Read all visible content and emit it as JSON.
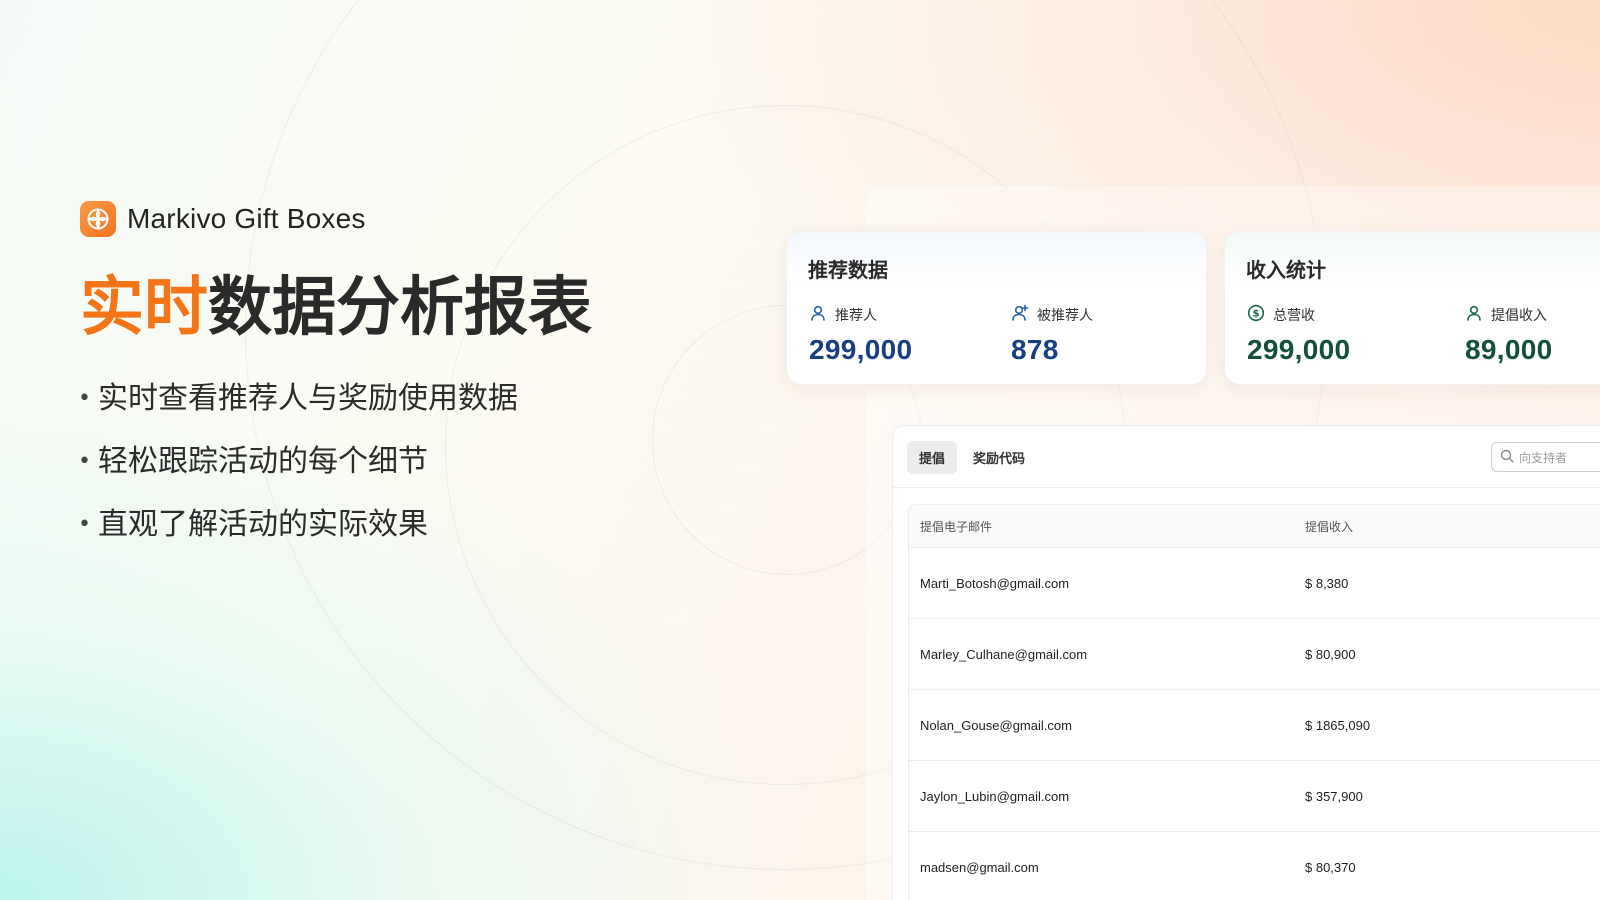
{
  "brand": {
    "name": "Markivo Gift Boxes"
  },
  "headline": {
    "accent": "实时",
    "rest": "数据分析报表"
  },
  "bullets": [
    "实时查看推荐人与奖励使用数据",
    "轻松跟踪活动的每个细节",
    "直观了解活动的实际效果"
  ],
  "referral_card": {
    "title": "推荐数据",
    "stats": [
      {
        "label": "推荐人",
        "value": "299,000",
        "icon": "user-icon"
      },
      {
        "label": "被推荐人",
        "value": "878",
        "icon": "user-add-icon"
      }
    ]
  },
  "income_card": {
    "title": "收入统计",
    "stats": [
      {
        "label": "总营收",
        "value": "299,000",
        "icon": "dollar-circle-icon"
      },
      {
        "label": "提倡收入",
        "value": "89,000",
        "icon": "user-icon"
      }
    ]
  },
  "tabs": [
    {
      "label": "提倡",
      "active": true
    },
    {
      "label": "奖励代码",
      "active": false
    }
  ],
  "search": {
    "placeholder": "向支持者"
  },
  "table": {
    "headers": [
      "提倡电子邮件",
      "提倡收入"
    ],
    "rows": [
      {
        "email": "Marti_Botosh@gmail.com",
        "income": "$ 8,380"
      },
      {
        "email": "Marley_Culhane@gmail.com",
        "income": "$ 80,900"
      },
      {
        "email": "Nolan_Gouse@gmail.com",
        "income": "$ 1865,090"
      },
      {
        "email": "Jaylon_Lubin@gmail.com",
        "income": "$ 357,900"
      },
      {
        "email": "madsen@gmail.com",
        "income": "$ 80,370"
      }
    ]
  },
  "colors": {
    "accent": "#f47418",
    "value_blue": "#173f82",
    "value_green": "#11513a"
  }
}
